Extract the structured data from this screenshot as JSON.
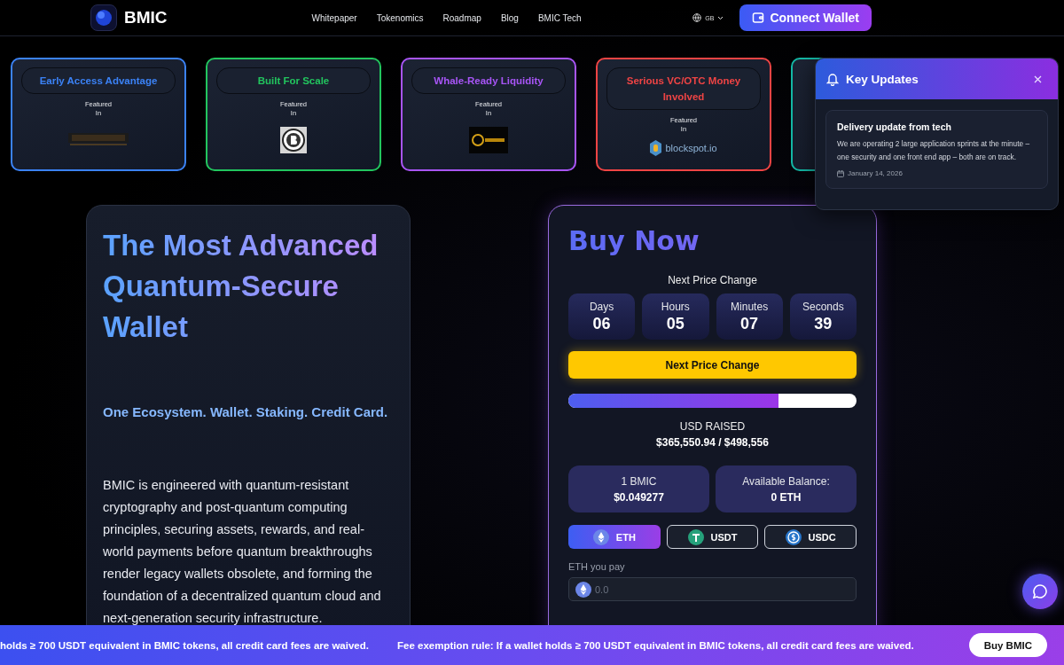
{
  "header": {
    "logo": "BMIC",
    "nav": [
      "Whitepaper",
      "Tokenomics",
      "Roadmap",
      "Blog",
      "BMIC Tech"
    ],
    "language": "GB",
    "connect_button": "Connect Wallet"
  },
  "feature_cards": [
    {
      "title": "Early Access Advantage",
      "featured": "Featured\nIn",
      "kind": "news",
      "color": "#3b82f6"
    },
    {
      "title": "Built For Scale",
      "featured": "Featured\nIn",
      "kind": "bitcoin",
      "color": "#22c55e"
    },
    {
      "title": "Whale-Ready Liquidity",
      "featured": "Featured\nIn",
      "kind": "gold",
      "color": "#a855f7"
    },
    {
      "title": "Serious VC/OTC Money Involved",
      "featured": "Featured\nIn",
      "kind": "blockspot",
      "logo_text": "blockspot.io",
      "color": "#ef4444"
    },
    {
      "kind": "none",
      "color": "#14b8a6"
    }
  ],
  "hero": {
    "title": "The Most Advanced Quantum-Secure Wallet",
    "subtitle": "One Ecosystem. Wallet. Staking. Credit Card.",
    "body": "BMIC is engineered with quantum-resistant cryptography and post-quantum computing principles, securing assets, rewards, and real-world payments before quantum breakthroughs render legacy wallets obsolete, and forming the foundation of a decentralized quantum cloud and next-generation security infrastructure."
  },
  "buy": {
    "title": "Buy Now",
    "countdown_label": "Next Price Change",
    "countdown": [
      {
        "unit": "Days",
        "value": "06"
      },
      {
        "unit": "Hours",
        "value": "05"
      },
      {
        "unit": "Minutes",
        "value": "07"
      },
      {
        "unit": "Seconds",
        "value": "39"
      }
    ],
    "price_button": "Next Price Change",
    "progress": {
      "level": 0.73
    },
    "raised_label": "USD RAISED",
    "raised": "$365,550.94 / $498,556",
    "stats": [
      {
        "label": "1 BMIC",
        "value": "$0.049277"
      },
      {
        "label": "Available Balance:",
        "value": "0 ETH"
      }
    ],
    "tokens": [
      {
        "kind": "eth",
        "label": "ETH",
        "selected": true
      },
      {
        "kind": "usdt",
        "label": "USDT",
        "selected": false
      },
      {
        "kind": "usdc",
        "label": "USDC",
        "selected": false
      }
    ],
    "pay_label": "ETH you pay",
    "pay_placeholder": "0.0"
  },
  "updates": {
    "title": "Key Updates",
    "item": {
      "title": "Delivery update from tech",
      "text": "We are operating 2 large application sprints at the minute – one security and one front end app – both are on track.",
      "date": "January 14, 2026"
    }
  },
  "banner": {
    "messages": [
      "holds ≥ 700 USDT equivalent in BMIC tokens, all credit card fees are waived.",
      "Fee exemption rule: If a wallet holds ≥ 700 USDT equivalent in BMIC tokens, all credit card fees are waived."
    ],
    "button": "Buy BMIC"
  }
}
